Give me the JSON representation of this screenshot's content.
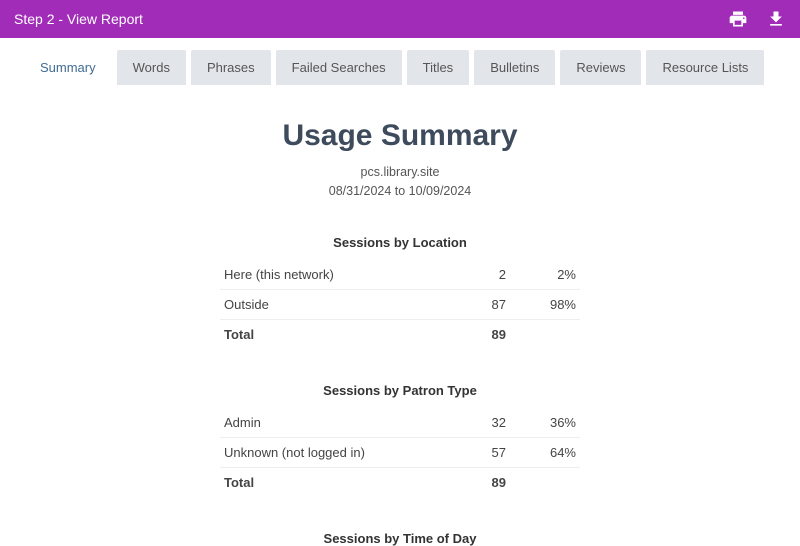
{
  "header": {
    "title": "Step 2 - View Report"
  },
  "tabs": {
    "summary": "Summary",
    "words": "Words",
    "phrases": "Phrases",
    "failed": "Failed Searches",
    "titles": "Titles",
    "bulletins": "Bulletins",
    "reviews": "Reviews",
    "resource": "Resource Lists"
  },
  "page": {
    "title": "Usage Summary",
    "site": "pcs.library.site",
    "range": "08/31/2024 to 10/09/2024"
  },
  "section1": {
    "title": "Sessions by Location",
    "row1": {
      "label": "Here (this network)",
      "count": "2",
      "pct": "2%"
    },
    "row2": {
      "label": "Outside",
      "count": "87",
      "pct": "98%"
    },
    "total": {
      "label": "Total",
      "count": "89"
    }
  },
  "section2": {
    "title": "Sessions by Patron Type",
    "row1": {
      "label": "Admin",
      "count": "32",
      "pct": "36%"
    },
    "row2": {
      "label": "Unknown (not logged in)",
      "count": "57",
      "pct": "64%"
    },
    "total": {
      "label": "Total",
      "count": "89"
    }
  },
  "section3": {
    "title": "Sessions by Time of Day"
  }
}
